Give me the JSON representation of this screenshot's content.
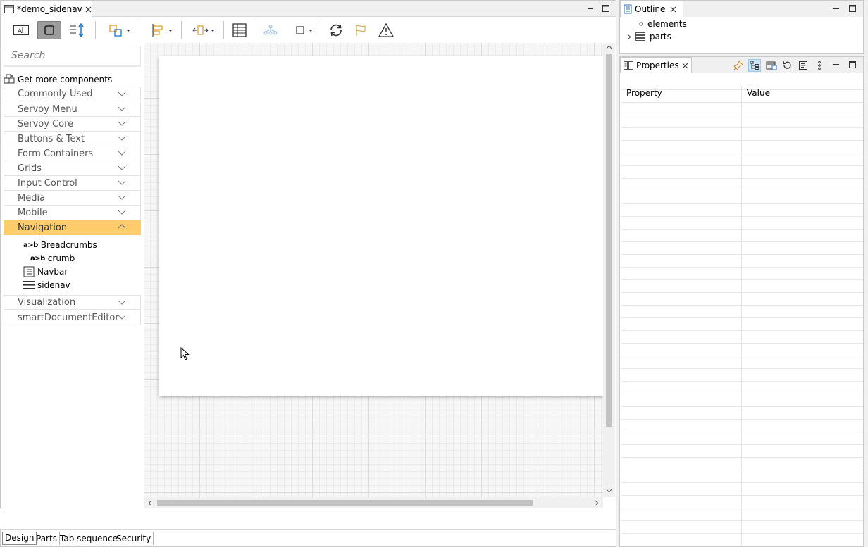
{
  "editor": {
    "tab_title": "*demo_sidenav"
  },
  "palette": {
    "search_placeholder": "Search",
    "get_more": "Get more components",
    "categories": [
      {
        "label": "Commonly Used"
      },
      {
        "label": "Servoy Menu"
      },
      {
        "label": "Servoy Core"
      },
      {
        "label": "Buttons & Text"
      },
      {
        "label": "Form Containers"
      },
      {
        "label": "Grids"
      },
      {
        "label": "Input Control"
      },
      {
        "label": "Media"
      },
      {
        "label": "Mobile"
      },
      {
        "label": "Navigation"
      },
      {
        "label": "Visualization"
      },
      {
        "label": "smartDocumentEditor"
      }
    ],
    "active_category": "Navigation",
    "navigation_components": [
      {
        "label": "Breadcrumbs",
        "icon": "a>b"
      },
      {
        "label": "crumb",
        "icon": "a>b"
      },
      {
        "label": "Navbar",
        "icon": "navbar-icon"
      },
      {
        "label": "sidenav",
        "icon": "hamburger-icon"
      }
    ]
  },
  "bottom_tabs": [
    {
      "label": "Design"
    },
    {
      "label": "Parts"
    },
    {
      "label": "Tab sequence"
    },
    {
      "label": "Security"
    }
  ],
  "selected_bottom_tab": "Design",
  "outline": {
    "title": "Outline",
    "items": [
      {
        "label": "elements"
      },
      {
        "label": "parts"
      }
    ]
  },
  "properties": {
    "title": "Properties",
    "col_property": "Property",
    "col_value": "Value"
  },
  "colors": {
    "active_category": "#ffcc6b",
    "pressed_toolbar": "#9c9c9c",
    "props_toggle": "#cde6f7"
  }
}
